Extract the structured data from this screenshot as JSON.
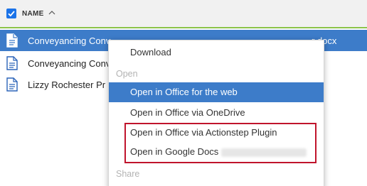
{
  "header": {
    "column_name": "NAME"
  },
  "files": [
    {
      "name": "Conveyancing Conv",
      "tail": "r docx",
      "selected": true
    },
    {
      "name": "Conveyancing Conv",
      "tail": "",
      "selected": false
    },
    {
      "name": "Lizzy Rochester Pr",
      "tail": "",
      "selected": false
    }
  ],
  "menu": {
    "download": "Download",
    "section_open": "Open",
    "open_office_web": "Open in Office for the web",
    "open_office_onedrive": "Open in Office via OneDrive",
    "open_office_actionstep": "Open in Office via Actionstep Plugin",
    "open_google_docs": "Open in Google Docs",
    "section_share": "Share"
  },
  "colors": {
    "accent": "#3d7cc9",
    "checkbox": "#1b73e8",
    "highlight": "#c0142c",
    "header_underline": "#8bc34a"
  },
  "icons": {
    "file": "document-icon",
    "check": "checkbox-checked-icon",
    "sort": "chevron-up-icon"
  }
}
